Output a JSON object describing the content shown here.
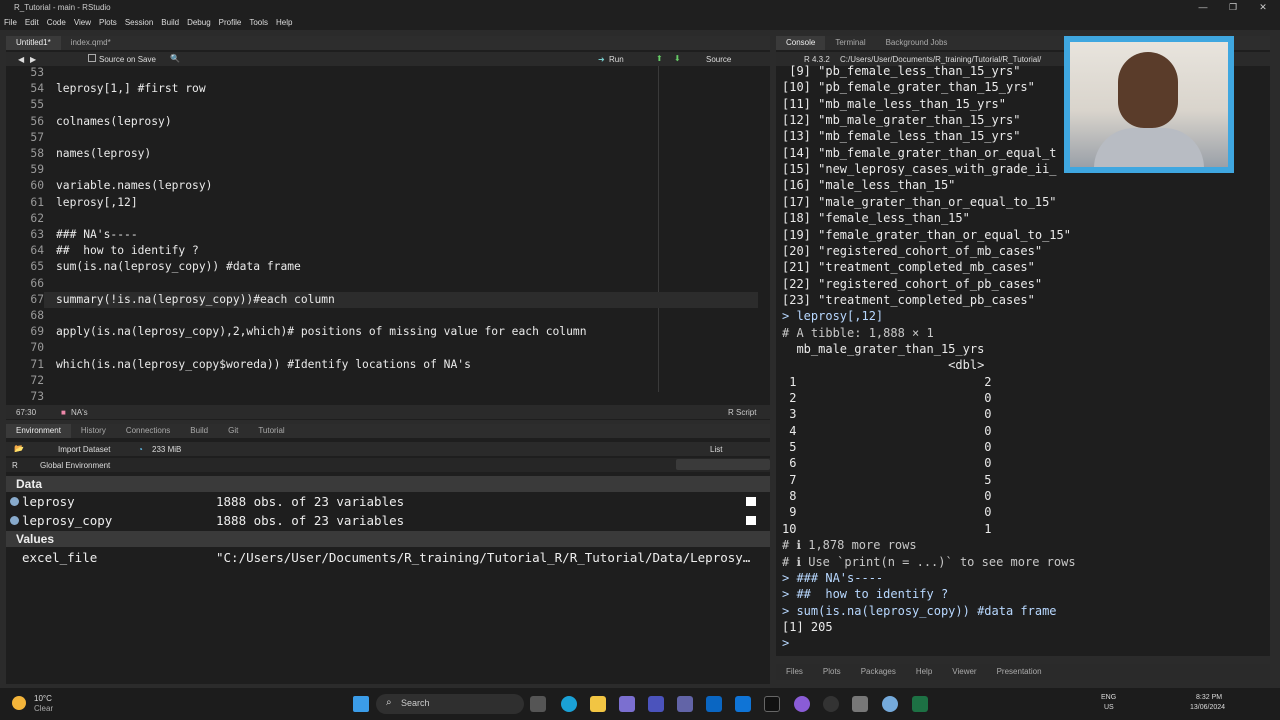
{
  "window": {
    "title": "R_Tutorial - main - RStudio",
    "minimize": "—",
    "maximize": "❐",
    "close": "✕"
  },
  "menu": [
    "File",
    "Edit",
    "Code",
    "View",
    "Plots",
    "Session",
    "Build",
    "Debug",
    "Profile",
    "Tools",
    "Help"
  ],
  "editor": {
    "tabs": [
      "Untitled1*",
      "index.qmd*"
    ],
    "toolbar": {
      "source_on_save": "Source on Save",
      "run": "Run",
      "source": "Source"
    },
    "lines": [
      {
        "n": "53",
        "t": ""
      },
      {
        "n": "54",
        "t": "leprosy[1,] #first row"
      },
      {
        "n": "55",
        "t": ""
      },
      {
        "n": "56",
        "t": "colnames(leprosy)"
      },
      {
        "n": "57",
        "t": ""
      },
      {
        "n": "58",
        "t": "names(leprosy)"
      },
      {
        "n": "59",
        "t": ""
      },
      {
        "n": "60",
        "t": "variable.names(leprosy)"
      },
      {
        "n": "61",
        "t": "leprosy[,12]"
      },
      {
        "n": "62",
        "t": ""
      },
      {
        "n": "63",
        "t": "### NA's----"
      },
      {
        "n": "64",
        "t": "##  how to identify ?"
      },
      {
        "n": "65",
        "t": "sum(is.na(leprosy_copy)) #data frame"
      },
      {
        "n": "66",
        "t": ""
      },
      {
        "n": "67",
        "t": "summary(!is.na(leprosy_copy))#each column"
      },
      {
        "n": "68",
        "t": ""
      },
      {
        "n": "69",
        "t": "apply(is.na(leprosy_copy),2,which)# positions of missing value for each column"
      },
      {
        "n": "70",
        "t": ""
      },
      {
        "n": "71",
        "t": "which(is.na(leprosy_copy$woreda)) #Identify locations of NA's"
      },
      {
        "n": "72",
        "t": ""
      },
      {
        "n": "73",
        "t": ""
      }
    ],
    "status": {
      "position": "67:30",
      "section": "NA's",
      "type": "R Script"
    }
  },
  "env": {
    "tabs": [
      "Environment",
      "History",
      "Connections",
      "Build",
      "Git",
      "Tutorial"
    ],
    "import": "Import Dataset",
    "memory": "233 MiB",
    "list": "List",
    "lang": "R",
    "scope": "Global Environment",
    "sections": {
      "data": "Data",
      "values": "Values"
    },
    "data_rows": [
      {
        "name": "leprosy",
        "desc": "1888 obs. of 23 variables"
      },
      {
        "name": "leprosy_copy",
        "desc": "1888 obs. of 23 variables"
      }
    ],
    "value_rows": [
      {
        "name": "excel_file",
        "desc": "\"C:/Users/User/Documents/R_training/Tutorial_R/R_Tutorial/Data/Leprosy…"
      }
    ]
  },
  "console": {
    "tabs": [
      "Console",
      "Terminal",
      "Background Jobs"
    ],
    "version": "R 4.3.2",
    "path": "C:/Users/User/Documents/R_training/Tutorial/R_Tutorial/",
    "lines": [
      " [9] \"pb_female_less_than_15_yrs\"",
      "[10] \"pb_female_grater_than_15_yrs\"",
      "[11] \"mb_male_less_than_15_yrs\"",
      "[12] \"mb_male_grater_than_15_yrs\"",
      "[13] \"mb_female_less_than_15_yrs\"",
      "[14] \"mb_female_grater_than_or_equal_t",
      "[15] \"new_leprosy_cases_with_grade_ii_",
      "[16] \"male_less_than_15\"",
      "[17] \"male_grater_than_or_equal_to_15\"",
      "[18] \"female_less_than_15\"",
      "[19] \"female_grater_than_or_equal_to_15\"",
      "[20] \"registered_cohort_of_mb_cases\"",
      "[21] \"treatment_completed_mb_cases\"",
      "[22] \"registered_cohort_of_pb_cases\"",
      "[23] \"treatment_completed_pb_cases\"",
      "> leprosy[,12]",
      "# A tibble: 1,888 × 1",
      "  mb_male_grater_than_15_yrs",
      "                       <dbl>",
      " 1                          2",
      " 2                          0",
      " 3                          0",
      " 4                          0",
      " 5                          0",
      " 6                          0",
      " 7                          5",
      " 8                          0",
      " 9                          0",
      "10                          1",
      "# ℹ 1,878 more rows",
      "# ℹ Use `print(n = ...)` to see more rows",
      "> ### NA's----",
      "> ##  how to identify ?",
      "> sum(is.na(leprosy_copy)) #data frame",
      "[1] 205",
      ">"
    ]
  },
  "files": {
    "tabs": [
      "Files",
      "Plots",
      "Packages",
      "Help",
      "Viewer",
      "Presentation"
    ]
  },
  "taskbar": {
    "temp": "10°C",
    "weather": "Clear",
    "search": "Search",
    "lang1": "ENG",
    "lang2": "US",
    "time": "8:32 PM",
    "date": "13/06/2024"
  }
}
